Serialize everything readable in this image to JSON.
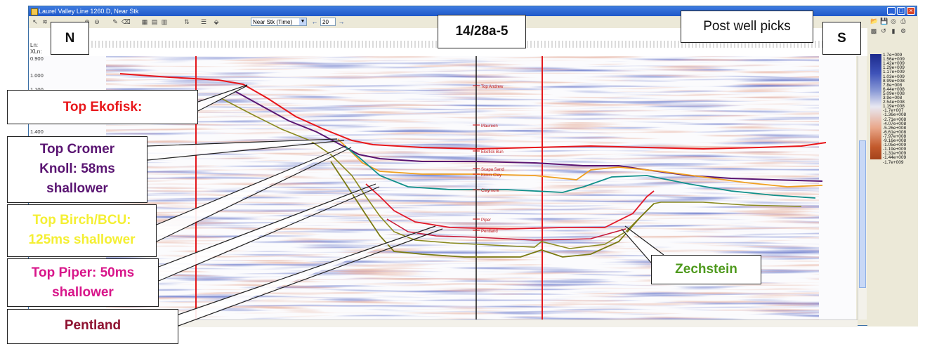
{
  "window": {
    "title": "Laurel Valley Line 1260.D, Near Stk",
    "controls": {
      "minimize": "_",
      "maximize": "□",
      "close": "×"
    }
  },
  "toolbar": {
    "volume_select": "Near Stk (Time)",
    "step_value": "20",
    "step_left_arrow": "←",
    "step_right_arrow": "→"
  },
  "axis": {
    "ln_label": "Ln:",
    "xln_label": "XLn:",
    "time_ticks": [
      "0.900",
      "1.000",
      "1.100",
      "1.400"
    ]
  },
  "colorbar": {
    "labels": [
      "1.7e+009",
      "1.56e+009",
      "1.42e+009",
      "1.29e+009",
      "1.17e+009",
      "1.03e+009",
      "8.99e+008",
      "7.8e+008",
      "6.44e+008",
      "5.09e+008",
      "3.9e+008",
      "2.54e+008",
      "1.19e+008",
      "-1.7e+007",
      "-1.36e+008",
      "-2.71e+008",
      "-4.07e+008",
      "-5.26e+008",
      "-6.61e+008",
      "-7.97e+008",
      "-9.16e+008",
      "-1.05e+009",
      "-1.19e+009",
      "-1.31e+009",
      "-1.44e+009",
      "-1.7e+009"
    ]
  },
  "well": {
    "name": "14/28a-5",
    "picks": [
      "Top Andrew",
      "Maureen",
      "Ekofisk Bun",
      "Scapa Sand",
      "Kimm Clay",
      "Claymore",
      "Piper",
      "Pentland"
    ]
  },
  "annotations": {
    "direction_left": "N",
    "direction_right": "S",
    "post_well_picks": "Post well picks",
    "top_ekofisk": "Top Ekofisk:",
    "top_cromer": [
      "Top Cromer",
      "Knoll: 58ms",
      "shallower"
    ],
    "top_birch": [
      "Top Birch/BCU:",
      "125ms shallower"
    ],
    "top_piper": [
      "Top Piper: 50ms",
      "shallower"
    ],
    "pentland": "Pentland",
    "zechstein": "Zechstein"
  },
  "colors": {
    "ekofisk": "#e8161a",
    "cromer": "#5a1572",
    "birch": "#f4ef33",
    "piper": "#d8168a",
    "pentland": "#8e1130",
    "zechstein": "#4f9a1e",
    "titlebar": "#1f58c9"
  }
}
